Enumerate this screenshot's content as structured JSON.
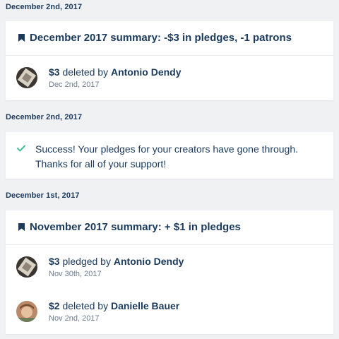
{
  "sections": [
    {
      "date": "December 2nd, 2017",
      "summary_title": "December 2017 summary: -$3 in pledges, -1 patrons",
      "activities": [
        {
          "amount": "$3",
          "action": "deleted by",
          "person": "Antonio Dendy",
          "date": "Dec 2nd, 2017",
          "avatar": "avatar-antonio"
        }
      ]
    },
    {
      "date": "December 2nd, 2017",
      "success_message": "Success! Your pledges for your creators have gone through. Thanks for all of your support!"
    },
    {
      "date": "December 1st, 2017",
      "summary_title": "November 2017 summary: + $1 in pledges",
      "activities": [
        {
          "amount": "$3",
          "action": "pledged by",
          "person": "Antonio Dendy",
          "date": "Nov 30th, 2017",
          "avatar": "avatar-antonio"
        },
        {
          "amount": "$2",
          "action": "deleted by",
          "person": "Danielle Bauer",
          "date": "Nov 2nd, 2017",
          "avatar": "avatar-danielle"
        }
      ]
    }
  ],
  "icons": {
    "summary": "bookmark-icon",
    "success": "checkmark-icon"
  },
  "colors": {
    "text": "#1b3a5c",
    "muted": "#6b7c8e",
    "success": "#3fbf8f",
    "background": "#f0f1f3"
  }
}
